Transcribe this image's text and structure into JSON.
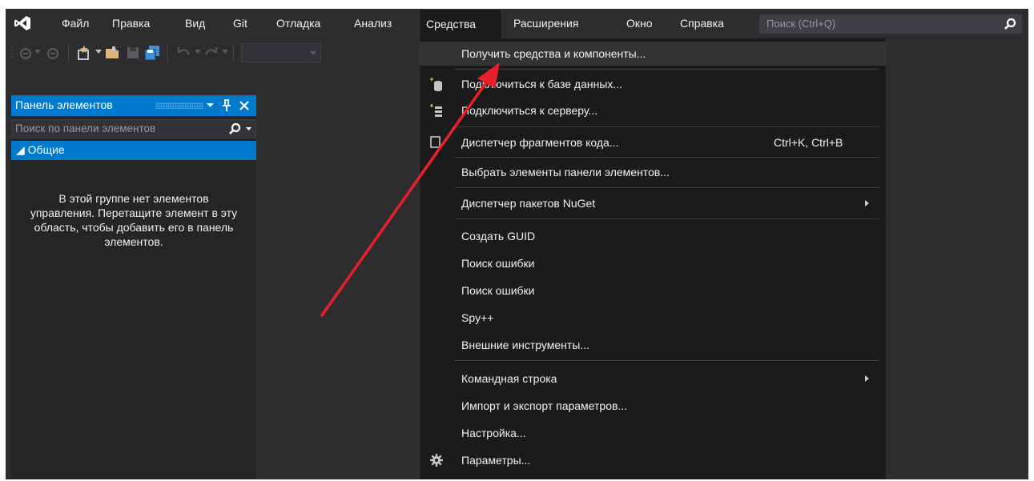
{
  "menubar": {
    "items": [
      {
        "label": "Файл"
      },
      {
        "label": "Правка"
      },
      {
        "label": "Вид"
      },
      {
        "label": "Git"
      },
      {
        "label": "Отладка"
      },
      {
        "label": "Анализ"
      },
      {
        "label": "Средства"
      },
      {
        "label": "Расширения"
      },
      {
        "label": "Окно"
      },
      {
        "label": "Справка"
      }
    ],
    "open_item": "Средства",
    "search_placeholder": "Поиск (Ctrl+Q)"
  },
  "toolbox": {
    "title": "Панель элементов",
    "search_placeholder": "Поиск по панели элементов",
    "group": "◢ Общие",
    "empty_message": "В этой группе нет элементов управления. Перетащите элемент в эту область, чтобы добавить его в панель элементов."
  },
  "dropdown": {
    "items": [
      {
        "label": "Получить средства и компоненты...",
        "highlighted": true
      },
      {
        "label": "Подключиться к базе данных...",
        "icon": "database-icon"
      },
      {
        "label": "Подключиться к серверу...",
        "icon": "server-icon"
      },
      {
        "label": "Диспетчер фрагментов кода...",
        "shortcut": "Ctrl+K, Ctrl+B",
        "icon": "snippet-icon"
      },
      {
        "label": "Выбрать элементы панели элементов..."
      },
      {
        "label": "Диспетчер пакетов NuGet",
        "submenu": true
      },
      {
        "label": "Создать GUID"
      },
      {
        "label": "Поиск ошибки"
      },
      {
        "label": "Поиск ошибки"
      },
      {
        "label": "Spy++"
      },
      {
        "label": "Внешние инструменты..."
      },
      {
        "label": "Командная строка",
        "submenu": true
      },
      {
        "label": "Импорт и экспорт параметров..."
      },
      {
        "label": "Настройка..."
      },
      {
        "label": "Параметры...",
        "icon": "gear-icon"
      }
    ]
  },
  "colors": {
    "background": "#2d2d30",
    "menu": "#1b1b1c",
    "accent": "#007acc",
    "annotation_arrow": "#e8202a"
  }
}
